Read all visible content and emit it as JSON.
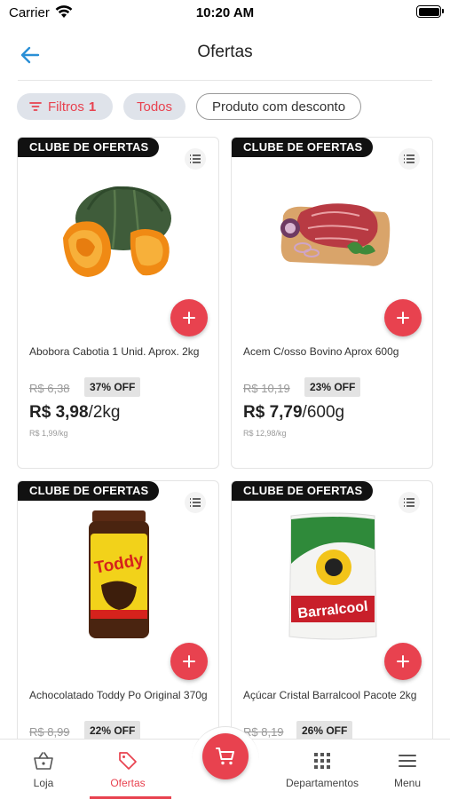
{
  "status_bar": {
    "carrier": "Carrier",
    "time": "10:20 AM"
  },
  "header": {
    "title": "Ofertas"
  },
  "filters": {
    "filtros_label": "Filtros",
    "filtros_count": "1",
    "todos_label": "Todos",
    "desconto_label": "Produto com desconto"
  },
  "products": [
    {
      "badge": "CLUBE DE OFERTAS",
      "name": "Abobora Cabotia 1 Unid. Aprox. 2kg",
      "old_price": "R$ 6,38",
      "discount": "37% OFF",
      "price": "R$ 3,98",
      "price_unit": "/2kg",
      "unit_price": "R$ 1,99/kg"
    },
    {
      "badge": "CLUBE DE OFERTAS",
      "name": "Acem C/osso Bovino Aprox 600g",
      "old_price": "R$ 10,19",
      "discount": "23% OFF",
      "price": "R$ 7,79",
      "price_unit": "/600g",
      "unit_price": "R$ 12,98/kg"
    },
    {
      "badge": "CLUBE DE OFERTAS",
      "name": "Achocolatado Toddy Po Original 370g",
      "old_price": "R$ 8,99",
      "discount": "22% OFF",
      "product_label": "Toddy"
    },
    {
      "badge": "CLUBE DE OFERTAS",
      "name": "Açúcar Cristal Barralcool Pacote 2kg",
      "old_price": "R$ 8,19",
      "discount": "26% OFF",
      "product_label": "Barralcool"
    }
  ],
  "bottom_nav": {
    "loja": "Loja",
    "ofertas": "Ofertas",
    "departamentos": "Departamentos",
    "menu": "Menu"
  },
  "colors": {
    "accent": "#e8424f",
    "chip_bg": "#dfe3ea",
    "badge_bg": "#111111"
  },
  "icons": [
    "wifi-icon",
    "battery-icon",
    "back-arrow-icon",
    "filter-icon",
    "list-icon",
    "plus-icon",
    "basket-icon",
    "tag-icon",
    "cart-icon",
    "grid-icon",
    "menu-icon"
  ]
}
